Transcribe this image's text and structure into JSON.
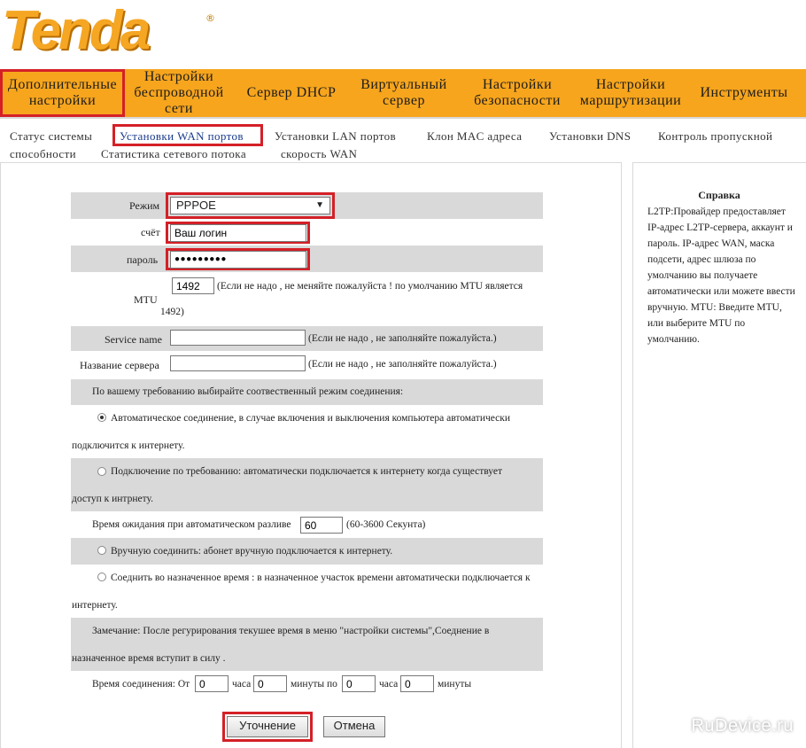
{
  "logo": {
    "text": "Tenda",
    "reg": "®"
  },
  "menu": [
    {
      "label": "Дополнительные настройки"
    },
    {
      "label": "Настройки беспроводной сети"
    },
    {
      "label": "Сервер DHCP"
    },
    {
      "label": "Виртуальный сервер"
    },
    {
      "label": "Настройки безопасности"
    },
    {
      "label": "Настройки маршрутизации"
    },
    {
      "label": "Инструменты"
    }
  ],
  "submenu": [
    "Статус системы",
    "Установки WAN портов",
    "Установки LAN портов",
    "Клон MAC адреса",
    "Установки DNS",
    "Контроль пропускной",
    "способности",
    "Статистика сетевого потока",
    "скорость WAN"
  ],
  "form": {
    "mode_label": "Режим",
    "mode_value": "PPPOE",
    "account_label": "счёт",
    "account_value": "Ваш логин",
    "password_label": "пароль",
    "password_value": "●●●●●●●●●",
    "mtu_label": "MTU",
    "mtu_value": "1492",
    "mtu_hint": "(Если не надо , не меняйте пожалуйста ! по умолчанию MTU является",
    "mtu_hint2": "1492)",
    "service_label": "Service name",
    "service_value": "",
    "service_hint": "(Если не надо , не заполняйте пожалуйста.)",
    "server_label": "Название сервера",
    "server_value": "",
    "server_hint": "(Если не надо , не заполняйте пожалуйста.)",
    "mode_select_text": "По вашему требованию выбирайте соотвественный режим соединения:",
    "auto_text": "Автоматическое соединение, в случае включения и выключения компьютера автоматически",
    "auto_text2": "подключится к интернету.",
    "demand_text": "Подключение по требованию: автоматически подключается к интернету когда существует",
    "demand_text2": "доступ к интрнету.",
    "idle_label": "Время ожидания при автоматическом разливе",
    "idle_value": "60",
    "idle_hint": "(60-3600 Секунта)",
    "manual_text": "Вручную соединить: абонет вручную подключается к интернету.",
    "timed_text": "Соеднить во назначенное время : в назначенное участок времени автоматически подключается к",
    "timed_text2": "интернету.",
    "note_text": "Замечание: После регурирования текушее время в меню \"настройки системы\",Соеднение в",
    "note_text2": "назначенное время вступит в силу .",
    "conn_label": "Время соединения: От",
    "h1_value": "0",
    "hours1": "часа",
    "m1_value": "0",
    "min_to": "минуты по",
    "h2_value": "0",
    "hours2": "часа",
    "m2_value": "0",
    "min_end": "минуты"
  },
  "buttons": {
    "apply": "Уточнение",
    "cancel": "Отмена"
  },
  "help": {
    "title": "Справка",
    "text": "L2TP:Провайдер предоставляет IP-адрес L2TP-сервера, аккаунт и пароль. IP-адрес WAN, маска подсети, адрес шлюза по умолчанию вы получаете автоматически или можете ввести вручную. MTU: Введите MTU, или выберите MTU по умолчанию."
  },
  "watermark": "RuDevice.ru",
  "colors": {
    "accent": "#f7a51d",
    "highlight": "#d42027",
    "row_gray": "#d9d9d9"
  }
}
